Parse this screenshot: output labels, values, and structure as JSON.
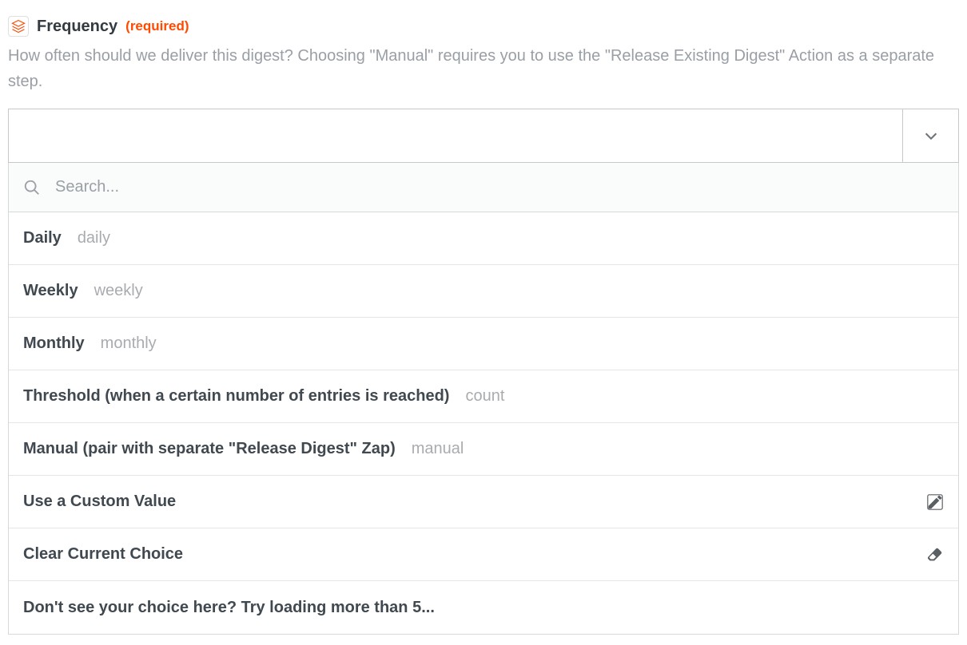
{
  "field": {
    "title": "Frequency",
    "required_tag": "(required)",
    "description": "How often should we deliver this digest? Choosing \"Manual\" requires you to use the \"Release Existing Digest\" Action as a separate step."
  },
  "dropdown": {
    "selected_value": "",
    "search_placeholder": "Search...",
    "options": [
      {
        "label": "Daily",
        "value": "daily"
      },
      {
        "label": "Weekly",
        "value": "weekly"
      },
      {
        "label": "Monthly",
        "value": "monthly"
      },
      {
        "label": "Threshold (when a certain number of entries is reached)",
        "value": "count"
      },
      {
        "label": "Manual (pair with separate \"Release Digest\" Zap)",
        "value": "manual"
      }
    ],
    "actions": {
      "custom_value": "Use a Custom Value",
      "clear_choice": "Clear Current Choice",
      "load_more": "Don't see your choice here? Try loading more than 5..."
    }
  }
}
